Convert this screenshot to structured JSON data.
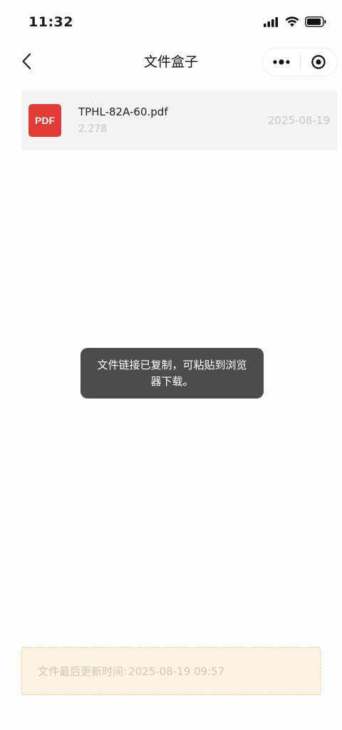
{
  "status_bar": {
    "time": "11:32",
    "icons": [
      "cellular-signal-icon",
      "wifi-icon",
      "battery-icon"
    ]
  },
  "nav": {
    "title": "文件盒子",
    "back_icon": "chevron-left-icon",
    "capsule_icons": [
      "more-dots-icon",
      "close-target-icon"
    ]
  },
  "files": [
    {
      "type_label": "PDF",
      "name": "TPHL-82A-60.pdf",
      "size": "2.278",
      "date": "2025-08-19"
    }
  ],
  "toast": {
    "message": "文件链接已复制，可粘贴到浏览器下载。"
  },
  "footer": {
    "label": "文件最后更新时间:",
    "timestamp": "2025-08-19 09:57"
  },
  "colors": {
    "pdf_red": "#e23a35",
    "toast_bg": "#4c4c4c",
    "notice_bg": "#fdf3e4",
    "notice_border": "#efcf9a"
  }
}
